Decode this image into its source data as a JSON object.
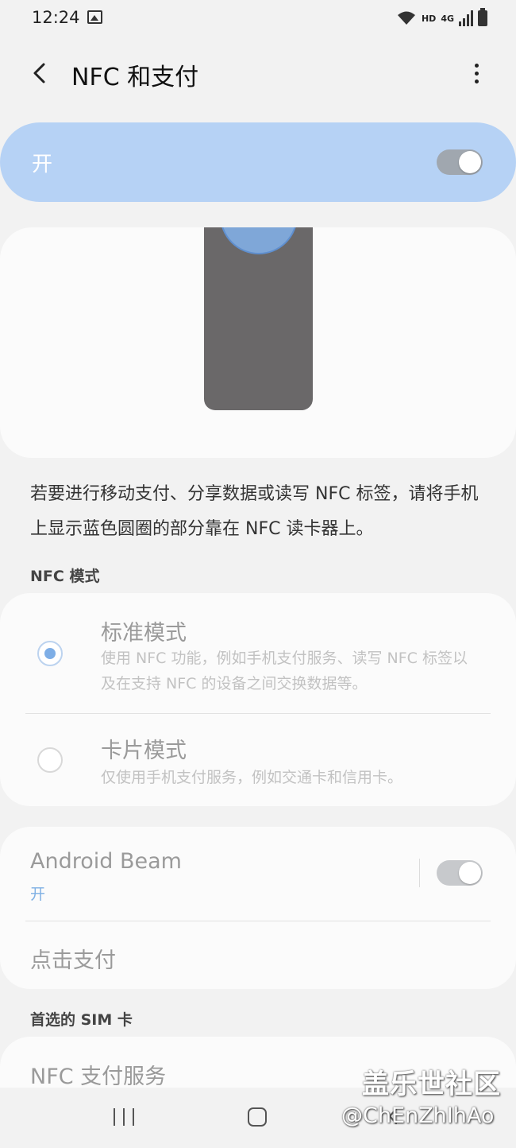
{
  "status_bar": {
    "time": "12:24",
    "hd_label": "HD",
    "network_label": "4G",
    "icons": [
      "image-icon",
      "wifi-icon",
      "signal-icon",
      "battery-icon"
    ]
  },
  "header": {
    "title": "NFC 和支付",
    "back_icon": "chevron-left-icon",
    "more_icon": "more-vertical-icon"
  },
  "master_switch": {
    "label": "开",
    "on": true
  },
  "description": "若要进行移动支付、分享数据或读写 NFC 标签，请将手机上显示蓝色圆圈的部分靠在 NFC 读卡器上。",
  "nfc_mode": {
    "section_title": "NFC 模式",
    "options": [
      {
        "title": "标准模式",
        "subtitle": "使用 NFC 功能，例如手机支付服务、读写 NFC 标签以及在支持 NFC 的设备之间交换数据等。",
        "selected": true
      },
      {
        "title": "卡片模式",
        "subtitle": "仅使用手机支付服务，例如交通卡和信用卡。",
        "selected": false
      }
    ]
  },
  "beam_card": {
    "android_beam_title": "Android Beam",
    "android_beam_status": "开",
    "android_beam_on": true,
    "tap_pay_label": "点击支付"
  },
  "sim_section": {
    "title": "首选的 SIM 卡",
    "payment_service_label": "NFC 支付服务"
  },
  "watermark": {
    "line1": "盖乐世社区",
    "line2": "@ChEnZhIhAo"
  },
  "colors": {
    "accent_blue": "#7eaee6",
    "master_bg": "#b6d2f5",
    "page_bg": "#f2f2f2"
  }
}
